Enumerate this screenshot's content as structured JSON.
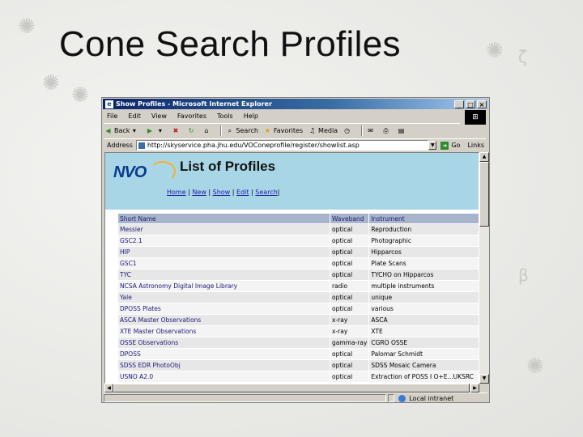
{
  "slide": {
    "title": "Cone Search Profiles"
  },
  "window": {
    "title": "Show Profiles - Microsoft Internet Explorer",
    "controls": {
      "minimize": "_",
      "maximize": "□",
      "close": "×"
    }
  },
  "menu": [
    "File",
    "Edit",
    "View",
    "Favorites",
    "Tools",
    "Help"
  ],
  "toolbar": {
    "back": "Back",
    "search": "Search",
    "favorites": "Favorites",
    "media": "Media"
  },
  "address": {
    "label": "Address",
    "url": "http://skyservice.pha.jhu.edu/VOConeprofile/register/showlist.asp",
    "go": "Go",
    "links": "Links"
  },
  "page": {
    "logo": "NVO",
    "heading": "List of Profiles",
    "nav": {
      "home": "Home",
      "new": "New",
      "show": "Show",
      "edit": "Edit",
      "search": "Search"
    },
    "columns": [
      "Short Name",
      "Waveband",
      "Instrument"
    ],
    "rows": [
      [
        "Messier",
        "optical",
        "Reproduction"
      ],
      [
        "GSC2.1",
        "optical",
        "Photographic"
      ],
      [
        "HIP",
        "optical",
        "Hipparcos"
      ],
      [
        "GSC1",
        "optical",
        "Plate Scans"
      ],
      [
        "TYC",
        "optical",
        "TYCHO on Hipparcos"
      ],
      [
        "NCSA Astronomy Digital Image Library",
        "radio",
        "multiple instruments"
      ],
      [
        "Yale",
        "optical",
        "unique"
      ],
      [
        "DPOSS Plates",
        "optical",
        "various"
      ],
      [
        "ASCA Master Observations",
        "x-ray",
        "ASCA"
      ],
      [
        "XTE Master Observations",
        "x-ray",
        "XTE"
      ],
      [
        "OSSE Observations",
        "gamma-ray",
        "CGRO OSSE"
      ],
      [
        "DPOSS",
        "optical",
        "Palomar Schmidt"
      ],
      [
        "SDSS EDR PhotoObj",
        "optical",
        "SDSS Mosaic Camera"
      ],
      [
        "USNO A2.0",
        "optical",
        "Extraction of POSS I O+E...UKSRC"
      ]
    ]
  },
  "status": {
    "zone": "Local intranet"
  },
  "colors": {
    "header_bg": "#a9d6e6",
    "table_header": "#a8b4cc",
    "titlebar": "#0a246a"
  }
}
